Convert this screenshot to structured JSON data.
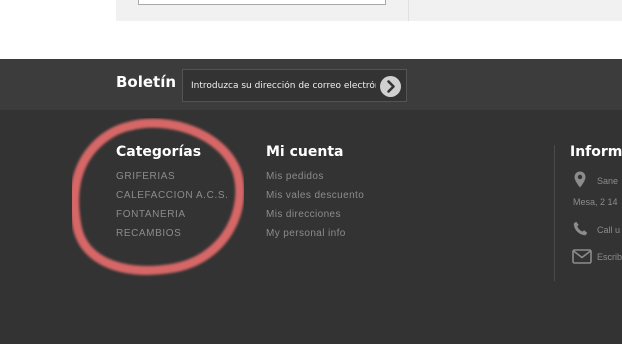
{
  "newsletter": {
    "title": "Boletín",
    "placeholder": "Introduzca su dirección de correo electrónico"
  },
  "footer": {
    "categories": {
      "title": "Categorías",
      "items": [
        "GRIFERIAS",
        "CALEFACCION A.C.S.",
        "FONTANERIA",
        "RECAMBIOS"
      ]
    },
    "account": {
      "title": "Mi cuenta",
      "items": [
        "Mis pedidos",
        "Mis vales descuento",
        "Mis direcciones",
        "My personal info"
      ]
    },
    "info": {
      "title": "Informa",
      "address_line1": "Sane",
      "address_line2": "Mesa, 2 14",
      "phone": "Call u",
      "email": "Escrib"
    }
  },
  "colors": {
    "footer_bg": "#333333",
    "newsletter_bg": "#3c3c3c",
    "annotation": "#e06a6a"
  }
}
